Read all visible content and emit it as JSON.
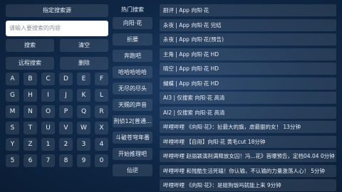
{
  "left": {
    "source_button": "指定搜索源",
    "search_placeholder": "请输入要搜索的内容",
    "search_button": "搜索",
    "clear_button": "清空",
    "remote_button": "远程搜索",
    "delete_button": "删除",
    "keys": [
      "A",
      "B",
      "C",
      "D",
      "E",
      "F",
      "G",
      "H",
      "I",
      "J",
      "K",
      "L",
      "M",
      "N",
      "O",
      "P",
      "Q",
      "R",
      "S",
      "T",
      "U",
      "V",
      "W",
      "X",
      "Y",
      "Z",
      "1",
      "2",
      "3",
      "4",
      "5",
      "6",
      "7",
      "8",
      "9",
      "0"
    ]
  },
  "hot": {
    "title": "热门搜索",
    "items": [
      "向阳·花",
      "折腰",
      "奔跑吧",
      "哈哈哈哈哈",
      "无尽的尽头",
      "天赐的声音",
      "刑侦12[普通...",
      "斗破苍穹年番",
      "开始推理吧",
      "仙逆"
    ]
  },
  "results": [
    "剧评 | App  向阳·花",
    "永夜 | App  向阳·花 完结",
    "永夜 | App  向阳·花(预告)",
    "主角 | App  向阳·花 HD",
    "晴空 | App  向阳·花 HD",
    "蝴蝶 | App  向阳·花 HD",
    "AI3 | 仅搜索  向阳·花 高清",
    "AI2 | 仅搜索  向阳·花 高清",
    "哔哩哔哩  《向阳·花》：扯最大的旗，虐最狠的女！ 13分钟",
    "哔哩哔哩  【自用】向阳·花 黄毛cut 18分钟",
    "哔哩哔哩  赵丽颖演刑满释放女囚！冯...花》首曝预告，定档04.04 0分钟",
    "哔哩哔哩  和残酷生活死磕！你认输，不认输的力量激荡人心！ 5分钟",
    "哔哩哔哩  《向阳·花》：是姐狗饭吗就能上来 9分钟"
  ]
}
